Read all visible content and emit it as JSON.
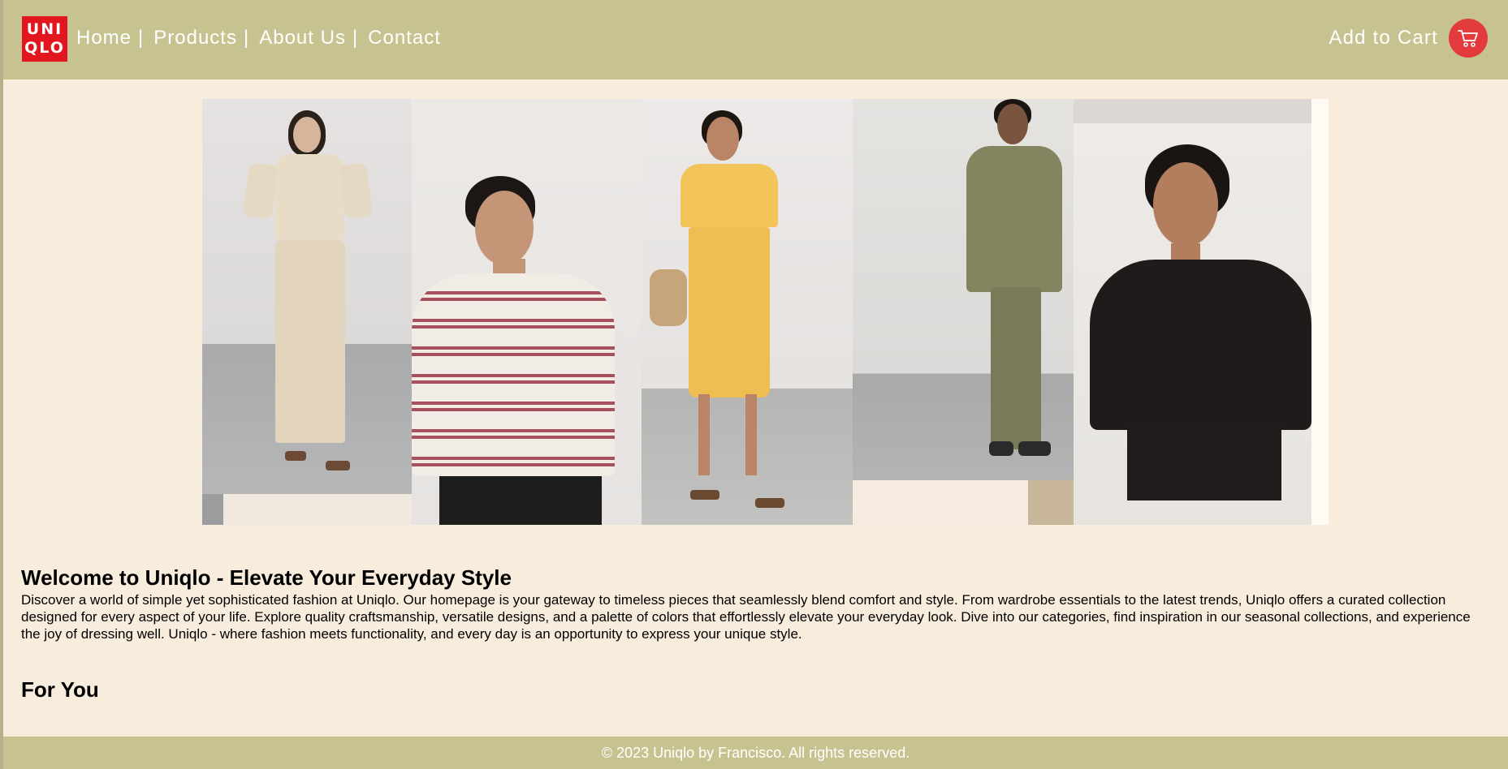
{
  "brand": {
    "logo_line1": "UNI",
    "logo_line2": "QLO",
    "accent": "#e1161f"
  },
  "nav": {
    "items": [
      {
        "label": "Home"
      },
      {
        "label": "Products"
      },
      {
        "label": "About Us"
      },
      {
        "label": "Contact"
      }
    ],
    "separator": "|"
  },
  "cart": {
    "label": "Add to Cart",
    "icon": "cart-icon"
  },
  "colors": {
    "header": "#c7c391",
    "background": "#f8ecdd",
    "cart_button": "#e33b3b"
  },
  "hero": {
    "description": "Collage of models wearing Uniqlo clothing"
  },
  "welcome": {
    "title": "Welcome to Uniqlo - Elevate Your Everyday Style",
    "text": "Discover a world of simple yet sophisticated fashion at Uniqlo. Our homepage is your gateway to timeless pieces that seamlessly blend comfort and style. From wardrobe essentials to the latest trends, Uniqlo offers a curated collection designed for every aspect of your life. Explore quality craftsmanship, versatile designs, and a palette of colors that effortlessly elevate your everyday look. Dive into our categories, find inspiration in our seasonal collections, and experience the joy of dressing well. Uniqlo - where fashion meets functionality, and every day is an opportunity to express your unique style."
  },
  "section": {
    "title": "For You"
  },
  "footer": {
    "text": "© 2023 Uniqlo by Francisco. All rights reserved."
  }
}
